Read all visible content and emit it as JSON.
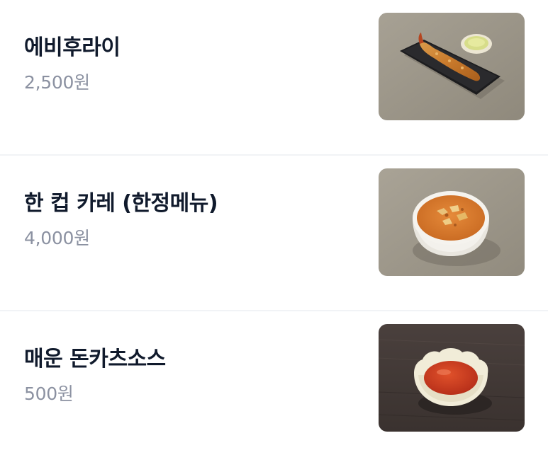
{
  "menu": {
    "items": [
      {
        "name": "에비후라이",
        "price": "2,500원",
        "photo_icon": "fried-shrimp-photo"
      },
      {
        "name": "한 컵 카레 (한정메뉴)",
        "price": "4,000원",
        "photo_icon": "curry-cup-photo"
      },
      {
        "name": "매운 돈카츠소스",
        "price": "500원",
        "photo_icon": "spicy-sauce-photo"
      }
    ]
  }
}
